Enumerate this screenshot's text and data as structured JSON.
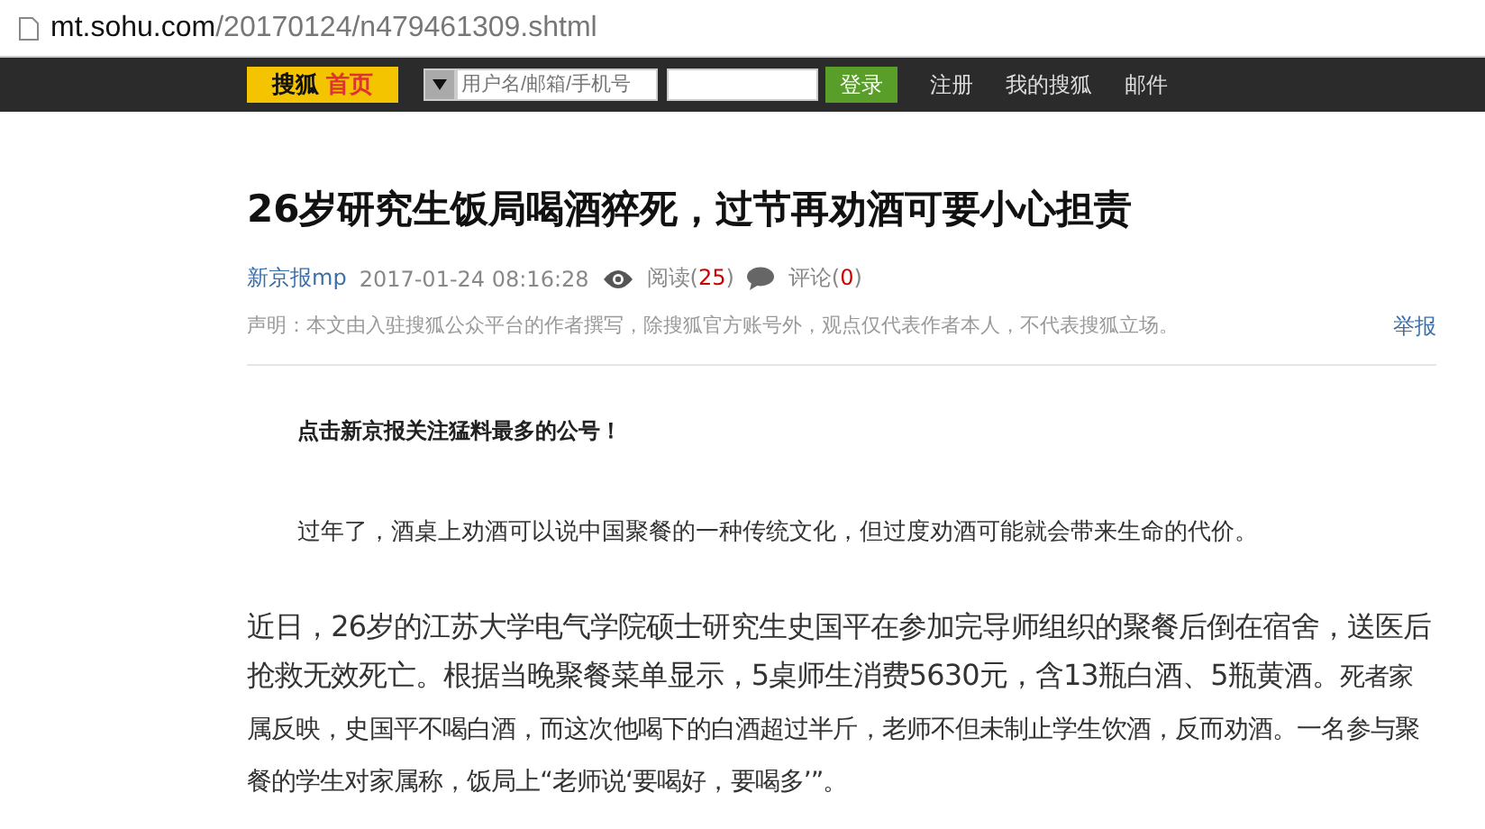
{
  "address_bar": {
    "url_host": "mt.sohu.com",
    "url_path": "/20170124/n479461309.shtml"
  },
  "nav": {
    "logo_brand": "搜狐",
    "logo_home": "首页",
    "username": {
      "placeholder": "用户名/邮箱/手机号"
    },
    "login_button": "登录",
    "links": [
      "注册",
      "我的搜狐",
      "邮件"
    ]
  },
  "article": {
    "title": "26岁研究生饭局喝酒猝死，过节再劝酒可要小心担责",
    "source": "新京报mp",
    "time": "2017-01-24 08:16:28",
    "reads_label": "阅读(",
    "reads_count": "25",
    "reads_close": ")",
    "comments_label": "评论(",
    "comments_count": "0",
    "comments_close": ")",
    "disclaimer": "声明：本文由入驻搜狐公众平台的作者撰写，除搜狐官方账号外，观点仅代表作者本人，不代表搜狐立场。",
    "report": "举报",
    "lead_bold": "点击新京报关注猛料最多的公号！",
    "intro": "过年了，酒桌上劝酒可以说中国聚餐的一种传统文化，但过度劝酒可能就会带来生命的代价。",
    "body_large": "近日，26岁的江苏大学电气学院硕士研究生史国平在参加完导师组织的聚餐后倒在宿舍，送医后抢救无效死亡。根据当晚聚餐菜单显示，5桌师生消费5630元，含13瓶白酒、5瓶黄酒。",
    "body_small": "死者家属反映，史国平不喝白酒，而这次他喝下的白酒超过半斤，老师不但未制止学生饮酒，反而劝酒。一名参与聚餐的学生对家属称，饭局上“老师说‘要喝好，要喝多’”。"
  }
}
